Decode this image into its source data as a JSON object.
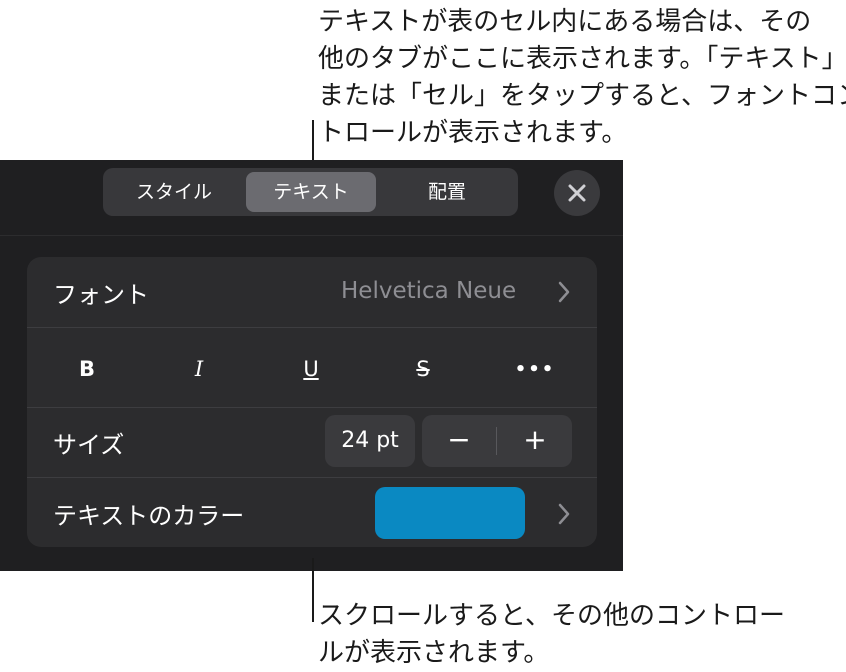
{
  "callout_top": {
    "lines": [
      "テキストが表のセル内にある場合は、その",
      "他のタブがここに表示されます。「テキスト」",
      "または「セル」をタップすると、フォントコン",
      "トロールが表示されます。"
    ]
  },
  "callout_bottom": {
    "lines": [
      "スクロールすると、その他のコントロー",
      "ルが表示されます。"
    ]
  },
  "tabs": [
    {
      "label": "スタイル",
      "selected": false
    },
    {
      "label": "テキスト",
      "selected": true
    },
    {
      "label": "配置",
      "selected": false
    }
  ],
  "close_icon": "close-icon",
  "font": {
    "label": "フォント",
    "value": "Helvetica Neue"
  },
  "style_buttons": {
    "bold": "B",
    "italic": "I",
    "underline": "U",
    "strike": "S",
    "more": "•••"
  },
  "size": {
    "label": "サイズ",
    "value": "24 pt",
    "minus": "−",
    "plus": "+"
  },
  "text_color": {
    "label": "テキストのカラー",
    "swatch": "#0a89c2"
  },
  "colors": {
    "panel": "#1f1f21",
    "card": "#2c2c2e",
    "selected_tab": "#6b6b70",
    "secondary_text": "#8e8e93"
  }
}
